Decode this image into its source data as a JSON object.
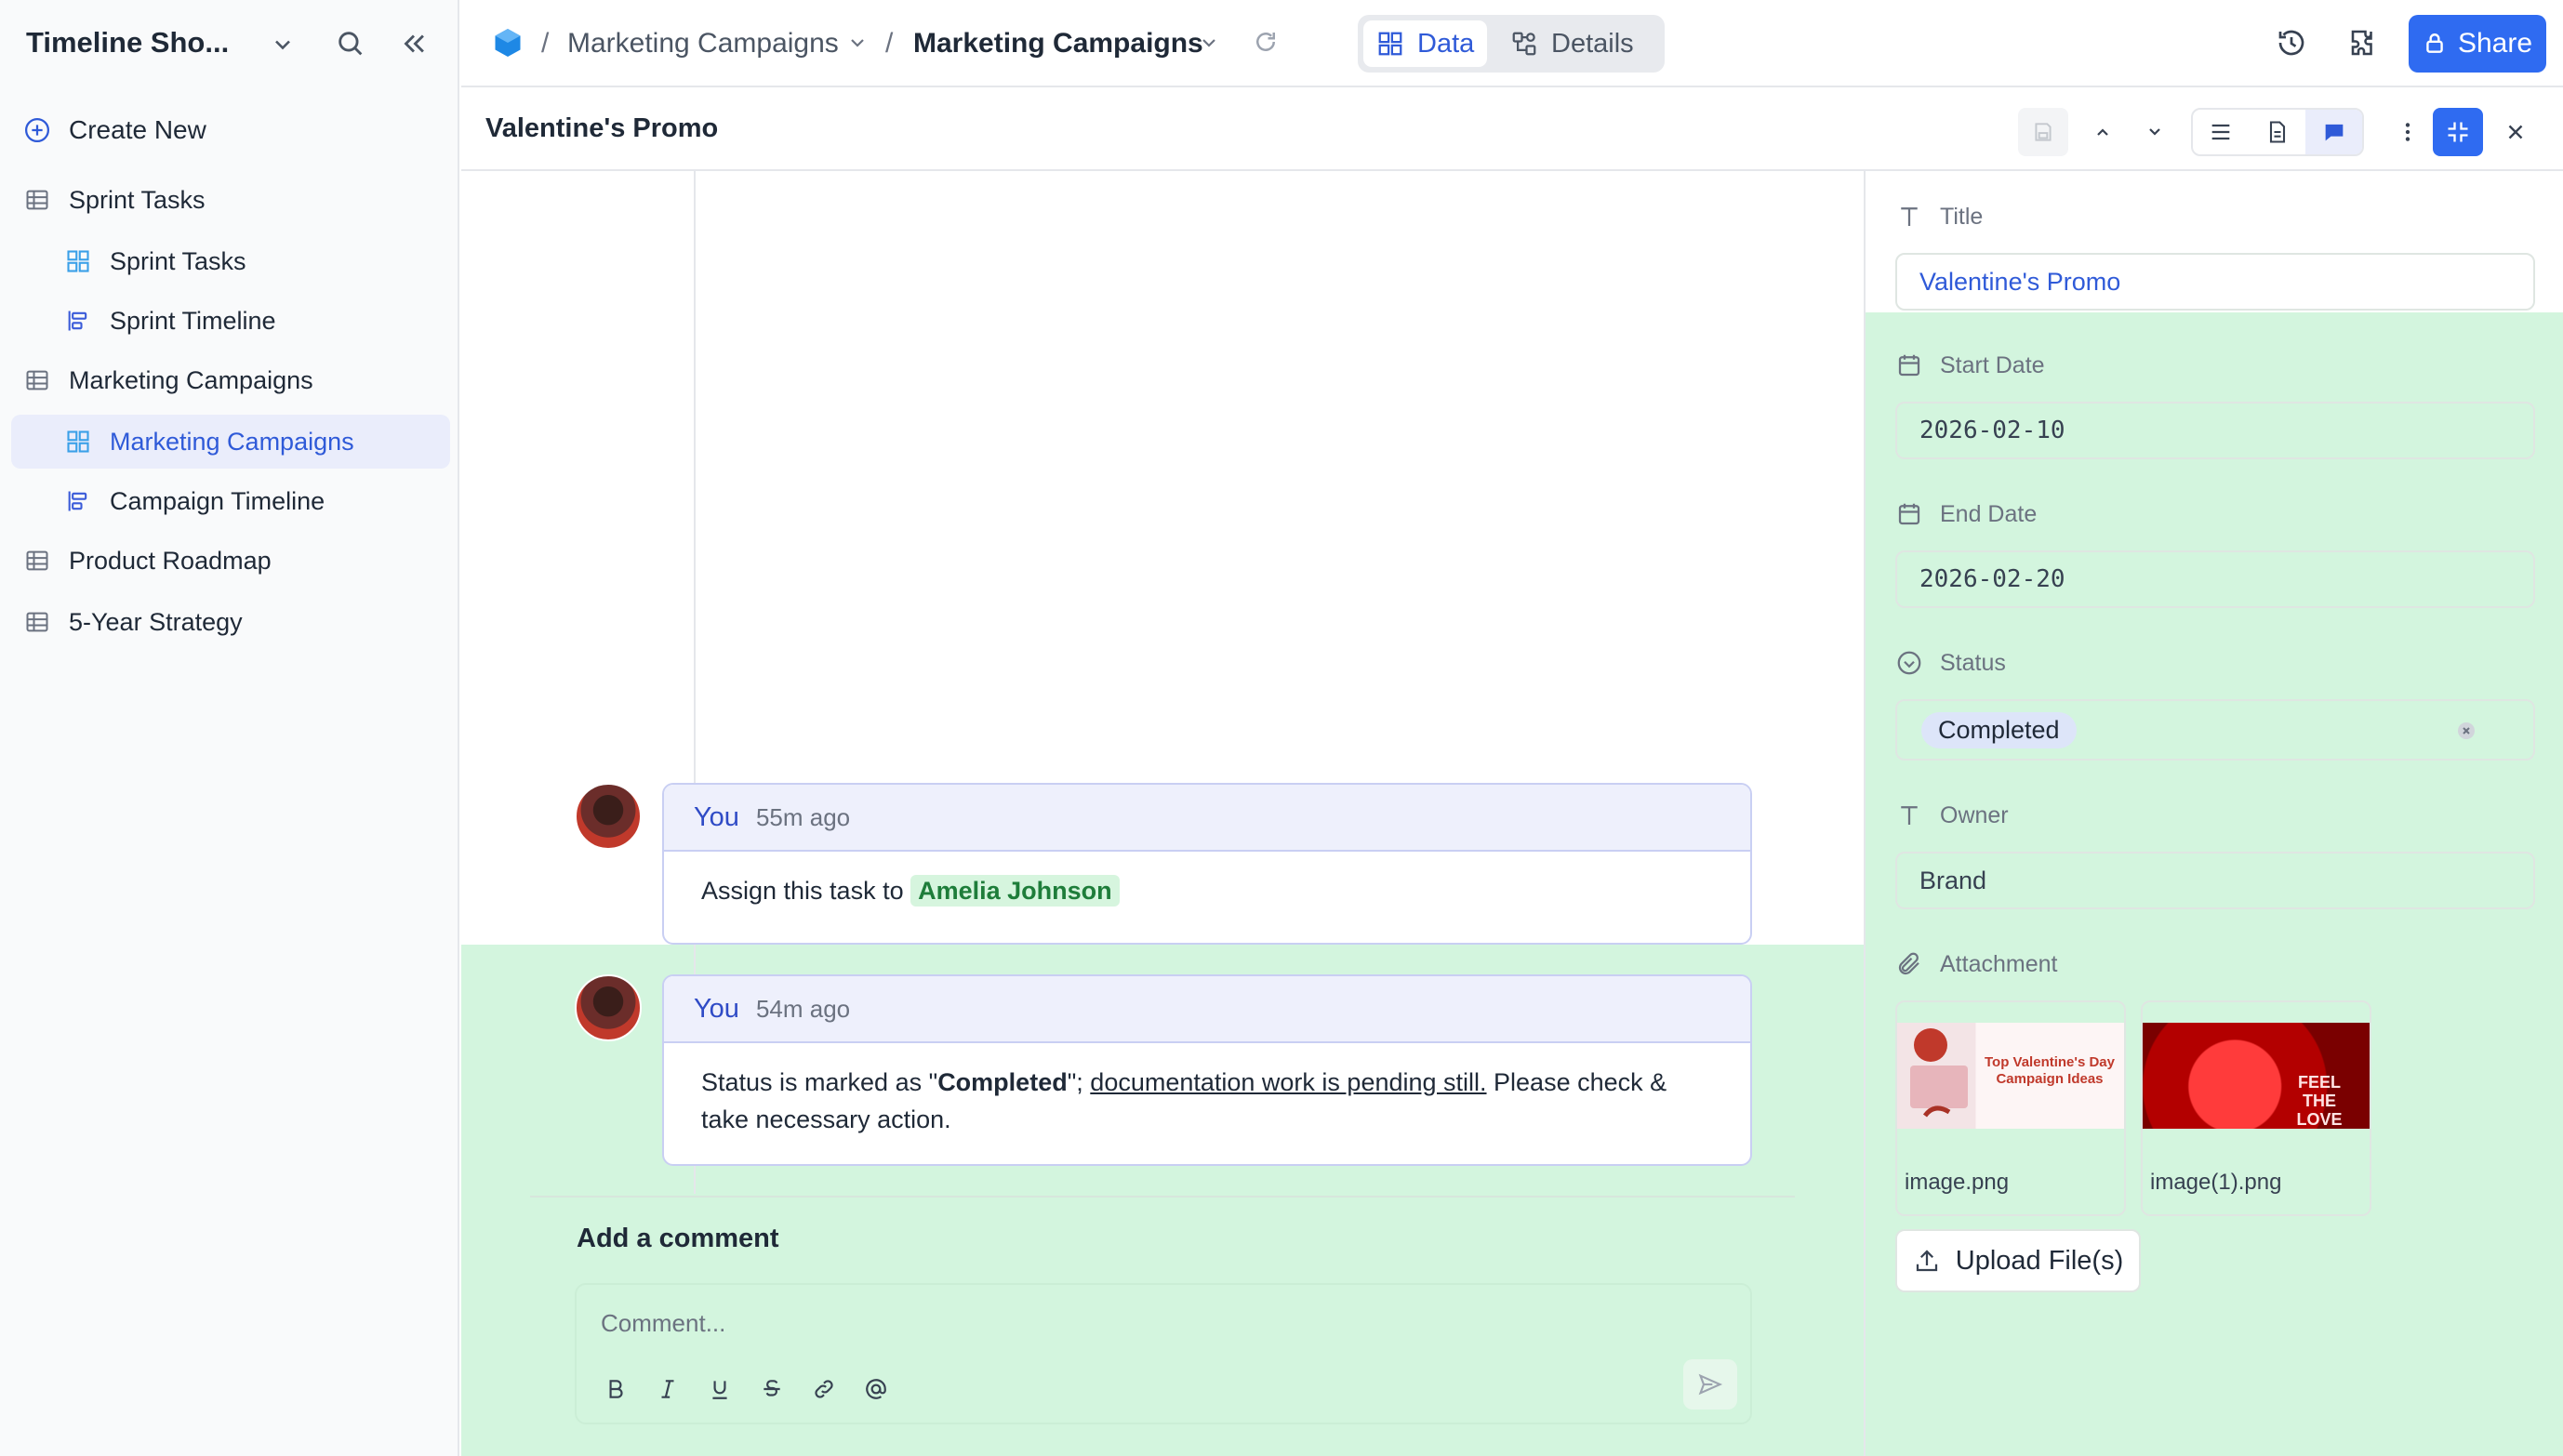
{
  "sidebar": {
    "workspace_title": "Timeline Sho...",
    "create_new": "Create New",
    "items": [
      {
        "label": "Sprint Tasks",
        "icon": "table-icon"
      },
      {
        "label": "Sprint Tasks",
        "icon": "grid-view-icon"
      },
      {
        "label": "Sprint Timeline",
        "icon": "timeline-view-icon"
      },
      {
        "label": "Marketing Campaigns",
        "icon": "table-icon"
      },
      {
        "label": "Marketing Campaigns",
        "icon": "grid-view-icon",
        "active": true
      },
      {
        "label": "Campaign Timeline",
        "icon": "timeline-view-icon"
      },
      {
        "label": "Product Roadmap",
        "icon": "table-icon"
      },
      {
        "label": "5-Year Strategy",
        "icon": "table-icon"
      }
    ]
  },
  "topbar": {
    "breadcrumb_1": "Marketing Campaigns",
    "breadcrumb_2": "Marketing Campaigns",
    "tab_data": "Data",
    "tab_details": "Details",
    "share_label": "Share"
  },
  "record": {
    "title": "Valentine's Promo"
  },
  "comments": [
    {
      "author": "You",
      "time": "55m ago",
      "text": "Assign this task to ",
      "mention": "Amelia Johnson"
    },
    {
      "author": "You",
      "time": "54m ago",
      "text_prefix": "Status is marked as \"",
      "bold": "Completed",
      "text_mid": "\"; ",
      "underline": "documentation work is pending still.",
      "text_suffix": " Please check & take necessary action."
    }
  ],
  "composer": {
    "title": "Add a comment",
    "placeholder": "Comment..."
  },
  "fields": {
    "title_label": "Title",
    "title_value": "Valentine's Promo",
    "start_label": "Start Date",
    "start_value": "2026-02-10",
    "end_label": "End Date",
    "end_value": "2026-02-20",
    "status_label": "Status",
    "status_value": "Completed",
    "owner_label": "Owner",
    "owner_value": "Brand",
    "attachment_label": "Attachment",
    "attachments": [
      {
        "name": "image.png",
        "caption": "Top Valentine's Day Campaign Ideas"
      },
      {
        "name": "image(1).png",
        "caption": "FEEL THE LOVE"
      }
    ],
    "upload_label": "Upload File(s)"
  },
  "colors": {
    "accent": "#2f6bf1",
    "highlight_green": "#d3f5de",
    "active_nav": "#eaedfb"
  }
}
